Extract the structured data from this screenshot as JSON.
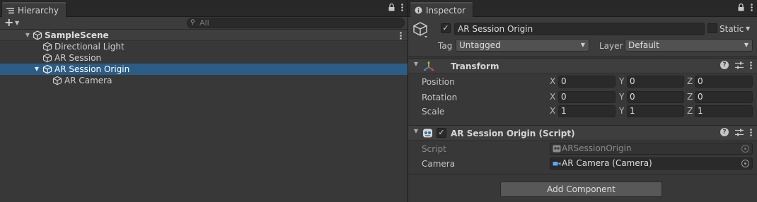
{
  "hierarchy": {
    "tab_title": "Hierarchy",
    "search_placeholder": "All",
    "scene_name": "SampleScene",
    "items": [
      {
        "label": "Directional Light"
      },
      {
        "label": "AR Session"
      },
      {
        "label": "AR Session Origin"
      },
      {
        "label": "AR Camera"
      }
    ]
  },
  "inspector": {
    "tab_title": "Inspector",
    "object_name": "AR Session Origin",
    "static_label": "Static",
    "tag_label": "Tag",
    "tag_value": "Untagged",
    "layer_label": "Layer",
    "layer_value": "Default",
    "transform": {
      "title": "Transform",
      "position_label": "Position",
      "rotation_label": "Rotation",
      "scale_label": "Scale",
      "axis_x": "X",
      "axis_y": "Y",
      "axis_z": "Z",
      "position": [
        "0",
        "0",
        "0"
      ],
      "rotation": [
        "0",
        "0",
        "0"
      ],
      "scale": [
        "1",
        "1",
        "1"
      ]
    },
    "script_component": {
      "title": "AR Session Origin (Script)",
      "script_label": "Script",
      "script_value": "ARSessionOrigin",
      "camera_label": "Camera",
      "camera_value": "AR Camera (Camera)"
    },
    "add_component_label": "Add Component"
  },
  "icons": {
    "lock": "lock-icon",
    "menu": "kebab-menu-icon",
    "info": "info-icon",
    "help": "help-icon",
    "preset": "preset-sliders-icon",
    "gameobject": "cube-icon",
    "transform": "transform-axes-icon",
    "script": "script-icon",
    "camera": "camera-icon"
  },
  "colors": {
    "selection": "#2c5d87",
    "panel": "#383838",
    "field": "#2a2a2a"
  }
}
